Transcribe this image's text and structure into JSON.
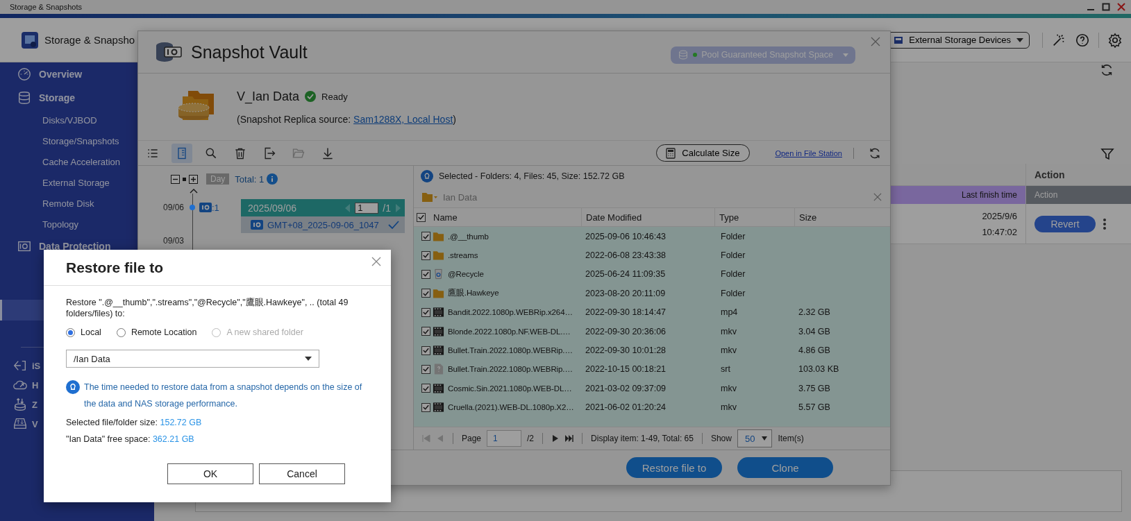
{
  "title_bar": {
    "title": "Storage & Snapshots"
  },
  "header": {
    "title": "Storage & Snapsho",
    "device_menu": "External Storage Devices"
  },
  "sidebar": {
    "sections": [
      {
        "label": "Overview"
      },
      {
        "label": "Storage",
        "children": [
          {
            "label": "Disks/VJBOD",
            "selected": false
          },
          {
            "label": "Storage/Snapshots",
            "selected": false
          },
          {
            "label": "Cache Acceleration",
            "selected": false
          },
          {
            "label": "External Storage",
            "selected": false
          },
          {
            "label": "Remote Disk",
            "selected": false
          },
          {
            "label": "Topology",
            "selected": false
          }
        ]
      },
      {
        "label": "Data Protection",
        "children": [
          {
            "selected": false
          },
          {
            "selected": false
          },
          {
            "selected": true
          },
          {
            "selected": false
          }
        ]
      },
      {
        "label": "iS"
      },
      {
        "label": "H"
      },
      {
        "label": "Z"
      },
      {
        "label": "V"
      }
    ]
  },
  "background_table": {
    "columns": [
      "Action"
    ],
    "subheader": [
      "Last finish time",
      "Action"
    ],
    "rows": [
      {
        "finish_date": "2025/9/6",
        "finish_time": "10:47:02",
        "action": "Revert"
      }
    ]
  },
  "vault": {
    "title": "Snapshot Vault",
    "pool_menu": "Pool Guaranteed Snapshot Space",
    "volume": {
      "name": "V_Ian Data",
      "status": "Ready",
      "source_prefix": "(Snapshot Replica source: ",
      "source_link": "Sam1288X, Local Host",
      "source_suffix": ")"
    },
    "tools": [
      {
        "selected": false,
        "disabled": false
      },
      {
        "selected": true,
        "disabled": false
      },
      {
        "selected": false,
        "disabled": false
      },
      {
        "selected": false,
        "disabled": false
      },
      {
        "selected": false,
        "disabled": false
      },
      {
        "selected": false,
        "disabled": true
      },
      {
        "selected": false,
        "disabled": false
      }
    ],
    "calculate_button": "Calculate Size",
    "file_station_link": "Open in File Station",
    "timeline": {
      "unit": "Day",
      "total": "Total: 1",
      "dates": [
        {
          "date": "09/06",
          "count": ":1"
        },
        {
          "date": "09/03"
        }
      ],
      "card": {
        "date": "2025/09/06",
        "page": "1",
        "page_total": "/1",
        "snapshots": [
          {
            "name": "GMT+08_2025-09-06_1047",
            "selected": true
          }
        ]
      }
    },
    "files": {
      "summary": "Selected - Folders: 4, Files: 45, Size: 152.72 GB",
      "path": "Ian Data",
      "all_checked": true,
      "columns": [
        "Name",
        "Date Modified",
        "Type",
        "Size"
      ],
      "rows": [
        {
          "kind": "folder",
          "name": ".@__thumb",
          "modified": "2025-09-06 10:46:43",
          "type": "Folder",
          "checked": true
        },
        {
          "kind": "folder",
          "name": ".streams",
          "modified": "2022-06-08 23:43:38",
          "type": "Folder",
          "checked": true
        },
        {
          "kind": "recycle",
          "name": "@Recycle",
          "modified": "2025-06-24 11:09:35",
          "type": "Folder",
          "checked": true
        },
        {
          "kind": "folder",
          "name": "鷹眼.Hawkeye",
          "modified": "2023-08-20 20:11:09",
          "type": "Folder",
          "checked": true
        },
        {
          "kind": "video",
          "name": "Bandit.2022.1080p.WEBRip.x264…",
          "modified": "2022-09-30 18:14:47",
          "type": "mp4",
          "size": "2.32 GB",
          "checked": true
        },
        {
          "kind": "video",
          "name": "Blonde.2022.1080p.NF.WEB-DL.…",
          "modified": "2022-09-30 20:36:06",
          "type": "mkv",
          "size": "3.04 GB",
          "checked": true
        },
        {
          "kind": "video",
          "name": "Bullet.Train.2022.1080p.WEBRip.…",
          "modified": "2022-09-30 10:01:28",
          "type": "mkv",
          "size": "4.86 GB",
          "checked": true
        },
        {
          "kind": "subtitle",
          "name": "Bullet.Train.2022.1080p.WEBRip.…",
          "modified": "2022-10-15 00:18:21",
          "type": "srt",
          "size": "103.03 KB",
          "checked": true
        },
        {
          "kind": "video",
          "name": "Cosmic.Sin.2021.1080p.WEB-DL…",
          "modified": "2021-03-02 09:37:09",
          "type": "mkv",
          "size": "3.75 GB",
          "checked": true
        },
        {
          "kind": "video",
          "name": "Cruella.(2021).WEB-DL.1080p.X2…",
          "modified": "2021-06-02 01:20:24",
          "type": "mkv",
          "size": "5.57 GB",
          "checked": true
        }
      ]
    },
    "pager": {
      "page_label": "Page",
      "page": "1",
      "page_total": "/2",
      "display": "Display item: 1-49, Total: 65",
      "show_label": "Show",
      "page_size": "50",
      "items_label": "Item(s)"
    },
    "actions": [
      "Restore file to",
      "Clone"
    ]
  },
  "dialog": {
    "title": "Restore file to",
    "message": "Restore \".@__thumb\",\".streams\",\"@Recycle\",\"鷹眼.Hawkeye\", .. (total 49 folders/files) to:",
    "options": [
      {
        "label": "Local",
        "selected": true,
        "disabled": false
      },
      {
        "label": "Remote Location",
        "selected": false,
        "disabled": false
      },
      {
        "label": "A new shared folder",
        "selected": false,
        "disabled": true
      }
    ],
    "destination": "/Ian Data",
    "note": "The time needed to restore data from a snapshot depends on the size of the data and NAS storage performance.",
    "size_label": "Selected file/folder size: ",
    "size_value": "152.72 GB",
    "free_label": "\"Ian Data\" free space: ",
    "free_value": "362.21 GB",
    "buttons": [
      "OK",
      "Cancel"
    ]
  }
}
